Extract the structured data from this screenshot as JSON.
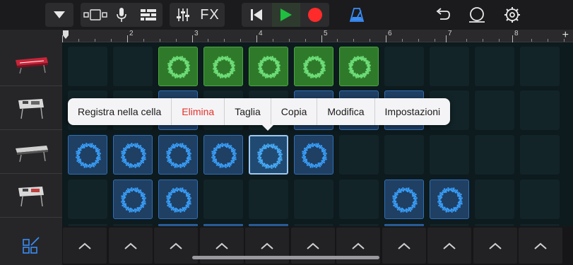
{
  "toolbar": {
    "fx_label": "FX",
    "colors": {
      "play": "#1fbf3f",
      "record": "#ff2a2a",
      "metronome": "#3a8df5"
    }
  },
  "ruler": {
    "bars": [
      "1",
      "2",
      "3",
      "4",
      "5",
      "6",
      "7",
      "8"
    ],
    "add_label": "+"
  },
  "tracks": [
    {
      "name": "synth-red-keyboard-icon"
    },
    {
      "name": "drum-machine-icon"
    },
    {
      "name": "keyboard-icon"
    },
    {
      "name": "drum-machine-icon"
    }
  ],
  "context_menu": {
    "items": [
      "Registra nella cella",
      "Elimina",
      "Taglia",
      "Copia",
      "Modifica",
      "Impostazioni"
    ]
  },
  "colors": {
    "accent": "#3a8df5",
    "green_cell": "#2f7a2a",
    "blue_cell": "#1f3f63",
    "danger": "#e5312b"
  }
}
